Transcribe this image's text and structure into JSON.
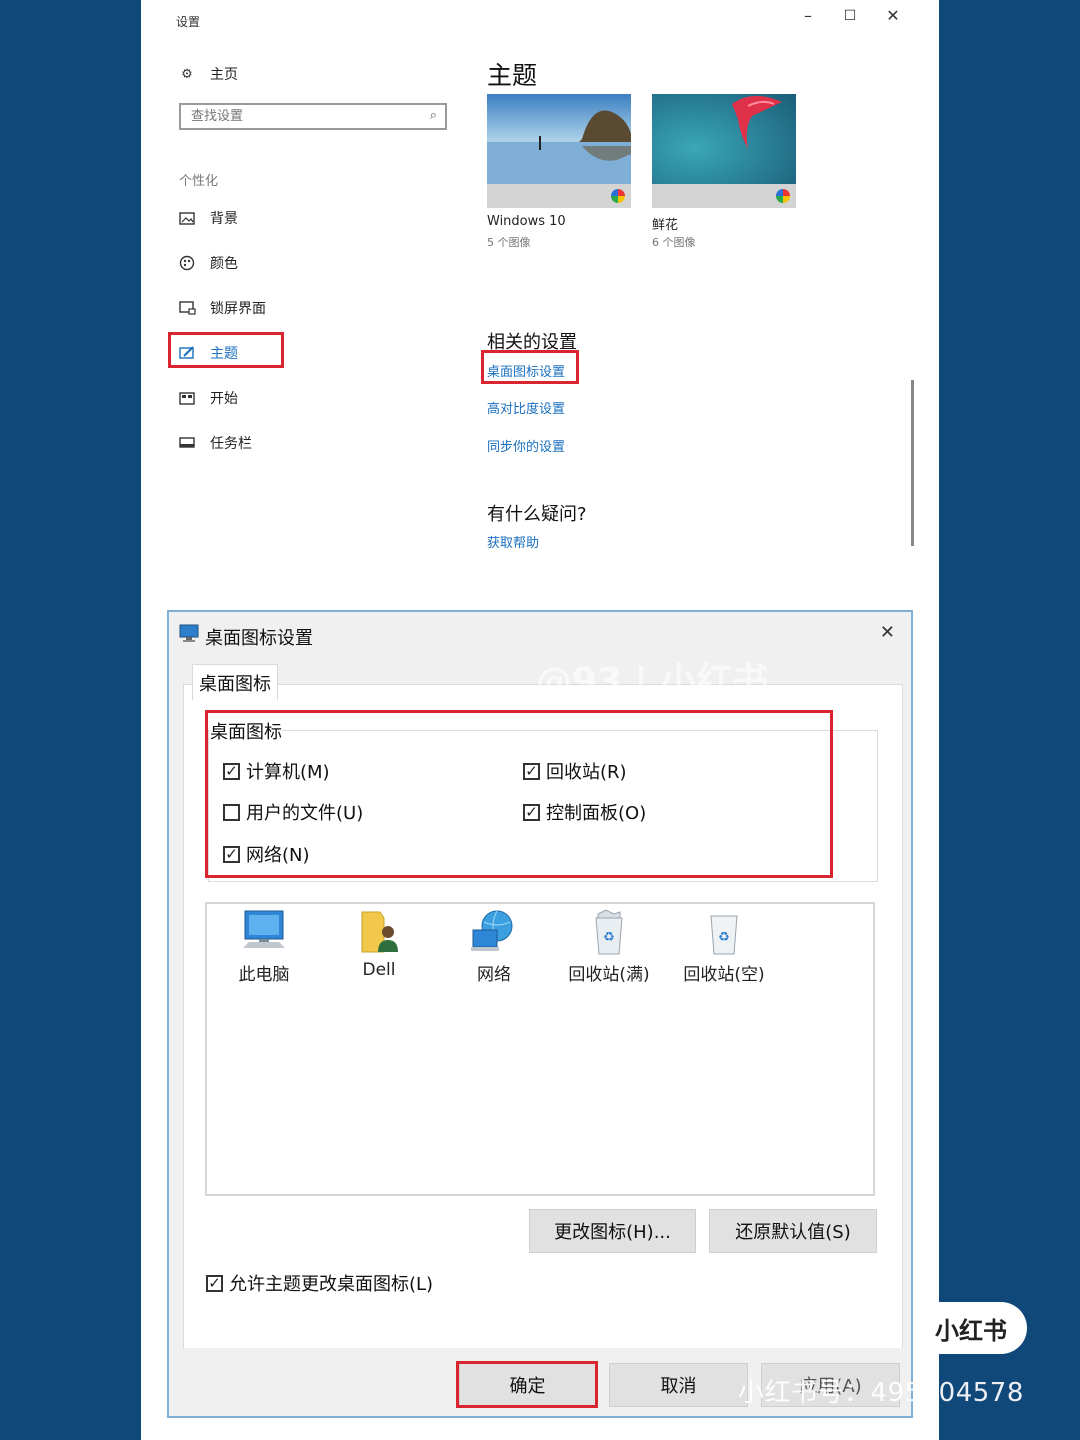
{
  "settings": {
    "window_title": "设置",
    "controls": {
      "minimize": "–",
      "maximize": "☐",
      "close": "✕"
    },
    "home_label": "主页",
    "search_placeholder": "查找设置",
    "section_label": "个性化",
    "nav": [
      {
        "label": "背景",
        "icon": "image-icon"
      },
      {
        "label": "颜色",
        "icon": "palette-icon"
      },
      {
        "label": "锁屏界面",
        "icon": "lock-screen-icon"
      },
      {
        "label": "主题",
        "icon": "theme-brush-icon",
        "selected": true
      },
      {
        "label": "开始",
        "icon": "start-icon"
      },
      {
        "label": "任务栏",
        "icon": "taskbar-icon"
      }
    ],
    "main": {
      "heading": "主题",
      "themes": [
        {
          "name": "Windows 10",
          "count": "5 个图像"
        },
        {
          "name": "鲜花",
          "count": "6 个图像"
        }
      ],
      "related_heading": "相关的设置",
      "related_links": [
        "桌面图标设置",
        "高对比度设置",
        "同步你的设置"
      ],
      "question_heading": "有什么疑问?",
      "help_link": "获取帮助"
    }
  },
  "dialog": {
    "title": "桌面图标设置",
    "close": "✕",
    "tab": "桌面图标",
    "group_label": "桌面图标",
    "checkboxes": [
      {
        "label": "计算机(M)",
        "checked": true
      },
      {
        "label": "回收站(R)",
        "checked": true
      },
      {
        "label": "用户的文件(U)",
        "checked": false
      },
      {
        "label": "控制面板(O)",
        "checked": true
      },
      {
        "label": "网络(N)",
        "checked": true
      }
    ],
    "icons": [
      "此电脑",
      "Dell",
      "网络",
      "回收站(满)",
      "回收站(空)"
    ],
    "change_icon_button": "更改图标(H)...",
    "restore_default_button": "还原默认值(S)",
    "allow_themes_label": "允许主题更改桌面图标(L)",
    "allow_themes_checked": true,
    "ok_button": "确定",
    "cancel_button": "取消",
    "apply_button": "应用(A)"
  },
  "watermarks": {
    "overlay": "@93 | 小红书",
    "badge": "小红书",
    "id_text": "小红书号：495404578"
  },
  "colors": {
    "highlight": "#d9252f",
    "link": "#1a6fbf",
    "background": "#11487a"
  }
}
